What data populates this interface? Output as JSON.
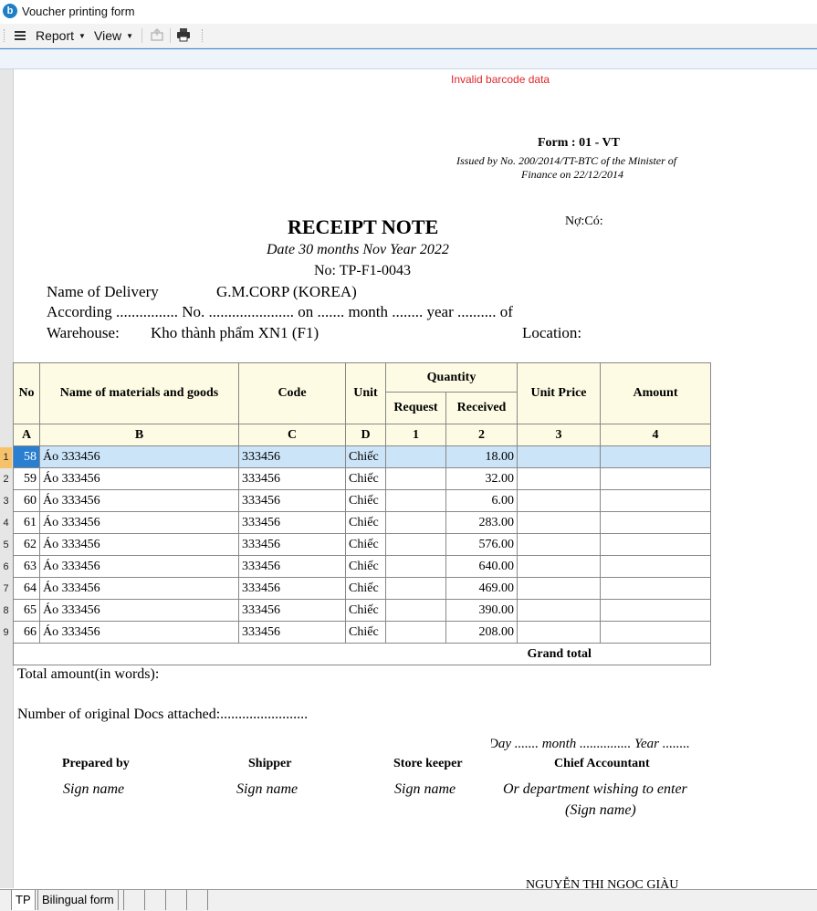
{
  "window": {
    "title": "Voucher printing form"
  },
  "toolbar": {
    "menu_report": "Report",
    "menu_view": "View"
  },
  "report": {
    "barcode_error": "Invalid barcode data",
    "form_no": "Form : 01 - VT",
    "issued_by_1": "Issued by No. 200/2014/TT-BTC of the Minister of",
    "issued_by_2": "Finance on 22/12/2014",
    "title": "RECEIPT NOTE",
    "no_co": "Nợ:Có:",
    "date_line": "Date 30 months Nov Year 2022",
    "no_line": "No: TP-F1-0043",
    "delivery_label": "Name of Delivery",
    "delivery_value": "G.M.CORP (KOREA)",
    "according_line": "According ................ No. ...................... on ....... month ........ year .......... of",
    "warehouse_label": "Warehouse:",
    "warehouse_value": "Kho thành phẩm XN1 (F1)",
    "location_label": "Location:",
    "table": {
      "headers": {
        "no": "No",
        "name": "Name of materials and goods",
        "code": "Code",
        "unit": "Unit",
        "quantity": "Quantity",
        "request": "Request",
        "received": "Received",
        "unit_price": "Unit Price",
        "amount": "Amount"
      },
      "letters": [
        "A",
        "B",
        "C",
        "D",
        "1",
        "2",
        "3",
        "4"
      ],
      "rows": [
        {
          "idx": "1",
          "no": "58",
          "name": "Áo 333456",
          "code": "333456",
          "unit": "Chiếc",
          "request": "",
          "received": "18.00",
          "price": "",
          "amount": ""
        },
        {
          "idx": "2",
          "no": "59",
          "name": "Áo 333456",
          "code": "333456",
          "unit": "Chiếc",
          "request": "",
          "received": "32.00",
          "price": "",
          "amount": ""
        },
        {
          "idx": "3",
          "no": "60",
          "name": "Áo 333456",
          "code": "333456",
          "unit": "Chiếc",
          "request": "",
          "received": "6.00",
          "price": "",
          "amount": ""
        },
        {
          "idx": "4",
          "no": "61",
          "name": "Áo 333456",
          "code": "333456",
          "unit": "Chiếc",
          "request": "",
          "received": "283.00",
          "price": "",
          "amount": ""
        },
        {
          "idx": "5",
          "no": "62",
          "name": "Áo 333456",
          "code": "333456",
          "unit": "Chiếc",
          "request": "",
          "received": "576.00",
          "price": "",
          "amount": ""
        },
        {
          "idx": "6",
          "no": "63",
          "name": "Áo 333456",
          "code": "333456",
          "unit": "Chiếc",
          "request": "",
          "received": "640.00",
          "price": "",
          "amount": ""
        },
        {
          "idx": "7",
          "no": "64",
          "name": "Áo 333456",
          "code": "333456",
          "unit": "Chiếc",
          "request": "",
          "received": "469.00",
          "price": "",
          "amount": ""
        },
        {
          "idx": "8",
          "no": "65",
          "name": "Áo 333456",
          "code": "333456",
          "unit": "Chiếc",
          "request": "",
          "received": "390.00",
          "price": "",
          "amount": ""
        },
        {
          "idx": "9",
          "no": "66",
          "name": "Áo 333456",
          "code": "333456",
          "unit": "Chiếc",
          "request": "",
          "received": "208.00",
          "price": "",
          "amount": ""
        }
      ],
      "grand_total_label": "Grand total"
    },
    "total_words": "Total amount(in words):",
    "docs_attached": "Number of original Docs attached:........................",
    "day_line": "Day ....... month ............... Year ........",
    "signatures": [
      {
        "role": "Prepared by",
        "hint": "Sign name"
      },
      {
        "role": "Shipper",
        "hint": "Sign name"
      },
      {
        "role": "Store keeper",
        "hint": "Sign name"
      },
      {
        "role": "Chief Accountant",
        "hint": "Or department wishing to enter",
        "hint2": "(Sign name)"
      }
    ],
    "signer_name": "NGUYỄN THỊ NGỌC GIÀU"
  },
  "bottom_tabs": [
    "TP",
    "Bilingual form"
  ],
  "colors": {
    "selected_row": "#cce4f7",
    "header_bg": "#fdfbe3",
    "error_text": "#e0262b",
    "accent": "#3a87d3"
  }
}
